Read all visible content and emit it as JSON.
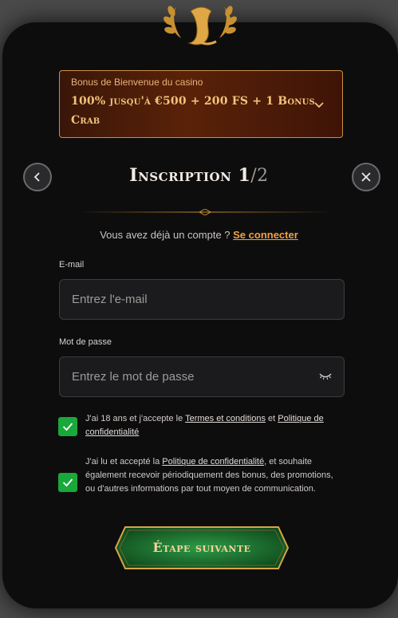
{
  "bonus": {
    "subtitle": "Bonus de Bienvenue du casino",
    "offer": "100% jusqu'à €500 + 200 FS + 1 Bonus Crab"
  },
  "header": {
    "title": "Inscription 1",
    "step": "/2"
  },
  "login": {
    "prompt": "Vous avez déjà un compte ? ",
    "link": "Se connecter"
  },
  "email": {
    "label": "E-mail",
    "placeholder": "Entrez l'e-mail"
  },
  "password": {
    "label": "Mot de passe",
    "placeholder": "Entrez le mot de passe"
  },
  "consent1": {
    "text_a": "J'ai 18 ans et j'accepte le ",
    "terms": "Termes et conditions",
    "and": " et ",
    "privacy": "Politique de confidentialité",
    "checked": true
  },
  "consent2": {
    "text_a": "J'ai lu et accepté la ",
    "privacy": "Politique de confidentialité",
    "text_b": ", et souhaite également recevoir périodiquement des bonus, des promotions, ou d'autres informations par tout moyen de communication.",
    "checked": true
  },
  "next_button": {
    "label": "Étape suivante"
  },
  "colors": {
    "accent": "#f0a145",
    "gold": "#c9913f",
    "checkbox": "#19a83a",
    "button_green": "#1f7a34"
  },
  "icons": [
    "logo-emblem",
    "chevron-down-icon",
    "back-arrow-icon",
    "close-icon",
    "eye-closed-icon",
    "check-icon"
  ]
}
